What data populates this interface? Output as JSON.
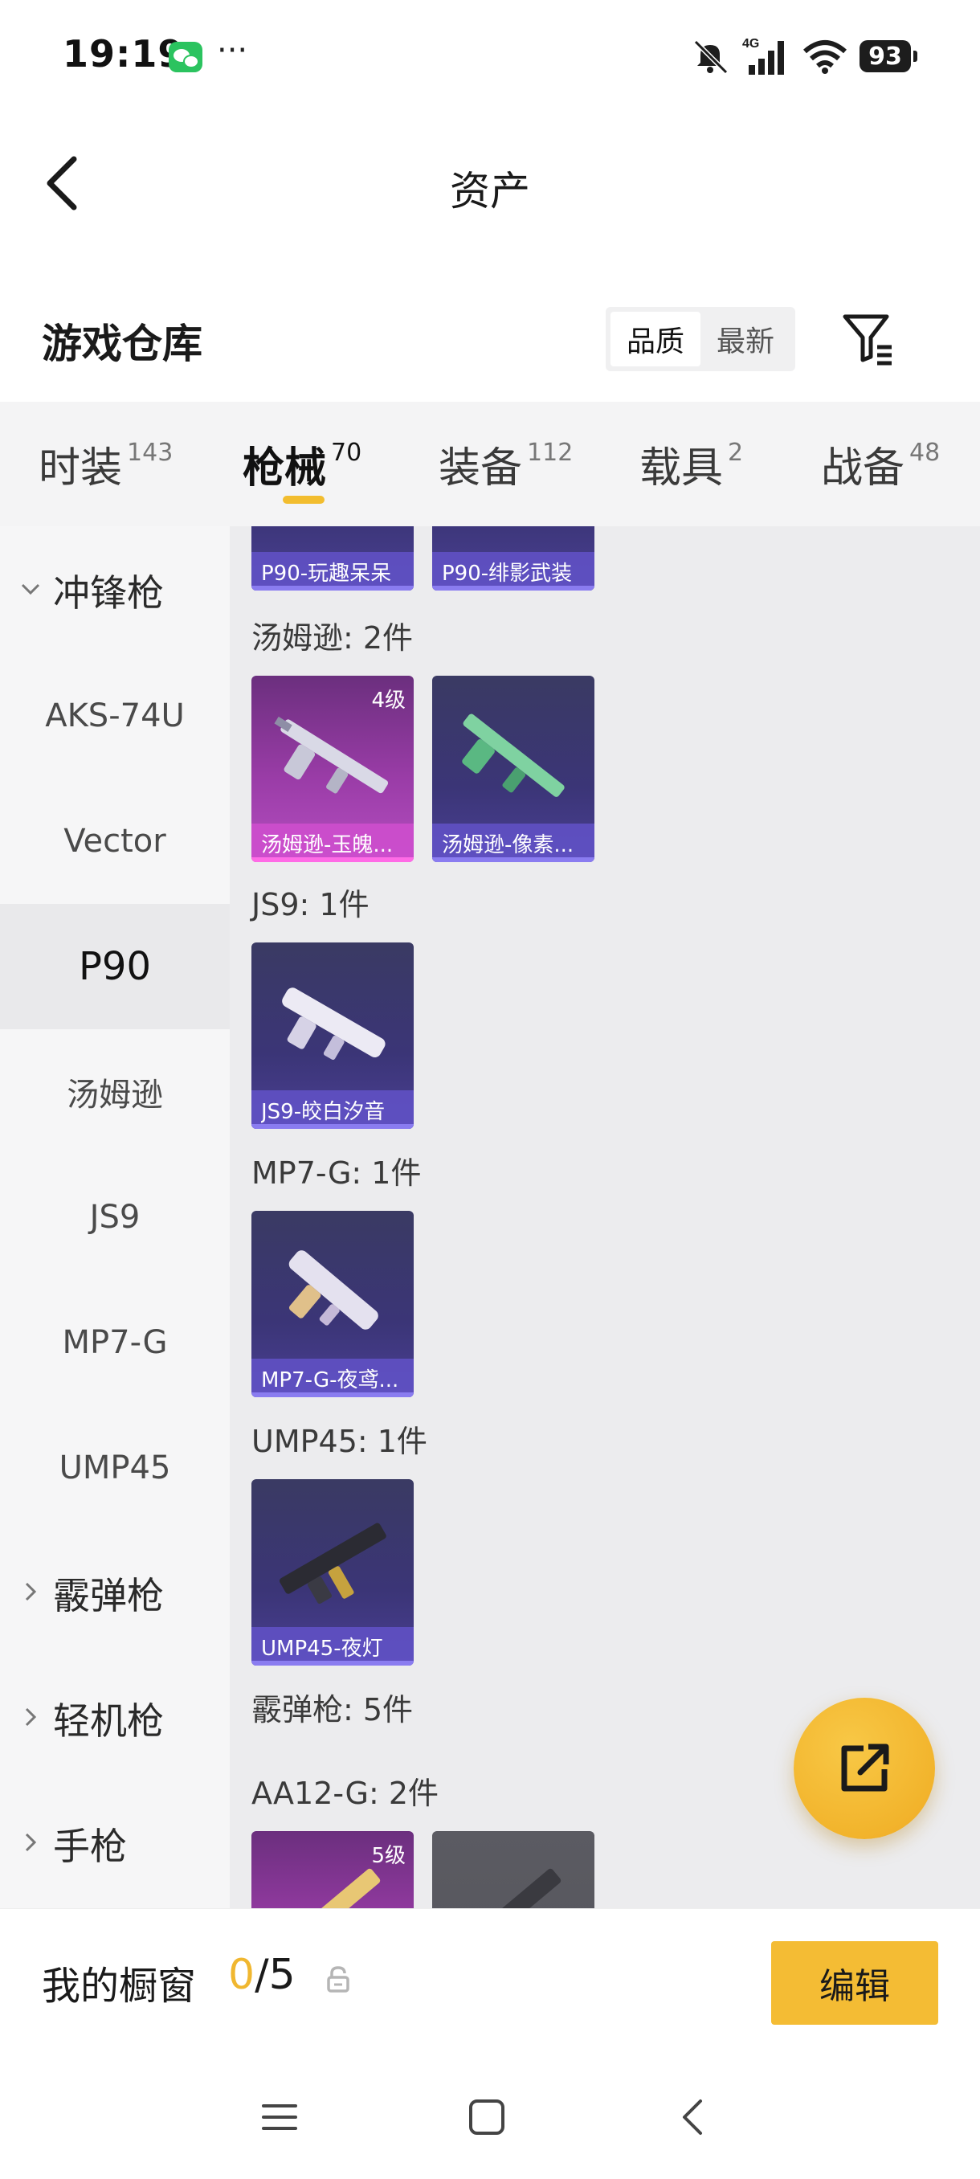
{
  "status_bar": {
    "time": "19:19",
    "network": "4G",
    "battery": "93",
    "icons": [
      "wechat-icon",
      "more-dots-icon",
      "mute-icon",
      "signal-icon",
      "wifi-icon",
      "battery-icon"
    ]
  },
  "header": {
    "title": "资产"
  },
  "section": {
    "title": "游戏仓库",
    "sort_options": [
      "品质",
      "最新"
    ],
    "sort_selected": "品质"
  },
  "tabs": [
    {
      "label": "时装",
      "count": "143"
    },
    {
      "label": "枪械",
      "count": "70",
      "active": true
    },
    {
      "label": "装备",
      "count": "112"
    },
    {
      "label": "载具",
      "count": "2"
    },
    {
      "label": "战备",
      "count": "48"
    }
  ],
  "categories": {
    "smg_group": "冲锋枪",
    "smg_items": [
      "AKS-74U",
      "Vector",
      "P90",
      "汤姆逊",
      "JS9",
      "MP7-G",
      "UMP45"
    ],
    "active": "P90",
    "shotgun_group": "霰弹枪",
    "lmg_group": "轻机枪",
    "pistol_group": "手枪"
  },
  "content": {
    "p90_cards": [
      "P90-玩趣呆呆",
      "P90-绯影武装"
    ],
    "thompson_title": "汤姆逊: 2件",
    "thompson_cards": [
      {
        "name": "汤姆逊-玉魄...",
        "level": "4级"
      },
      {
        "name": "汤姆逊-像素..."
      }
    ],
    "js9_title": "JS9: 1件",
    "js9_cards": [
      {
        "name": "JS9-皎白汐音"
      }
    ],
    "mp7_title": "MP7-G: 1件",
    "mp7_cards": [
      {
        "name": "MP7-G-夜鸢..."
      }
    ],
    "ump_title": "UMP45: 1件",
    "ump_cards": [
      {
        "name": "UMP45-夜灯"
      }
    ],
    "shotgun_title": "霰弹枪: 5件",
    "aa12_title": "AA12-G: 2件",
    "aa12_cards": [
      {
        "level": "5级"
      },
      {}
    ]
  },
  "showcase": {
    "label": "我的橱窗",
    "current": "0",
    "separator": "/",
    "max": "5",
    "edit_label": "编辑"
  },
  "colors": {
    "accent": "#f4bc34",
    "tab_underline": "#f2bd2f",
    "purple_card": "#3b3577",
    "pink_card": "#9a3ca7"
  }
}
